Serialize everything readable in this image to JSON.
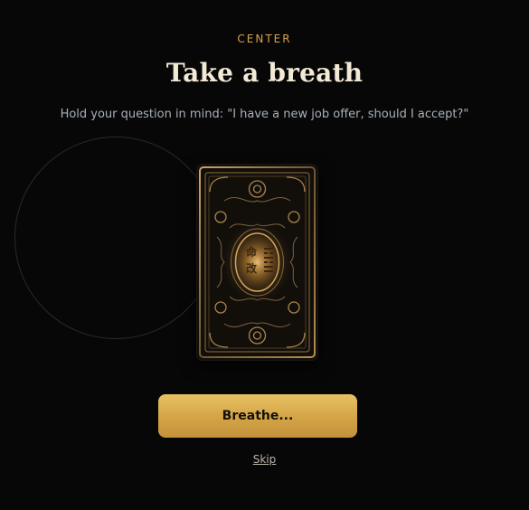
{
  "step": {
    "label": "CENTER"
  },
  "page": {
    "title": "Take a breath"
  },
  "prompt": {
    "text": "Hold your question in mind: \"I have a new job offer, should I accept?\""
  },
  "card": {
    "glyph_top": "命",
    "glyph_bottom": "改",
    "icon": "ornate-tarot-card-back"
  },
  "actions": {
    "breathe_label": "Breathe...",
    "skip_label": "Skip"
  },
  "colors": {
    "background": "#070707",
    "accent_gold": "#d9a24a",
    "button_gold": "#dcb054",
    "title": "#f3ead6",
    "muted_text": "#a8b0b8"
  }
}
